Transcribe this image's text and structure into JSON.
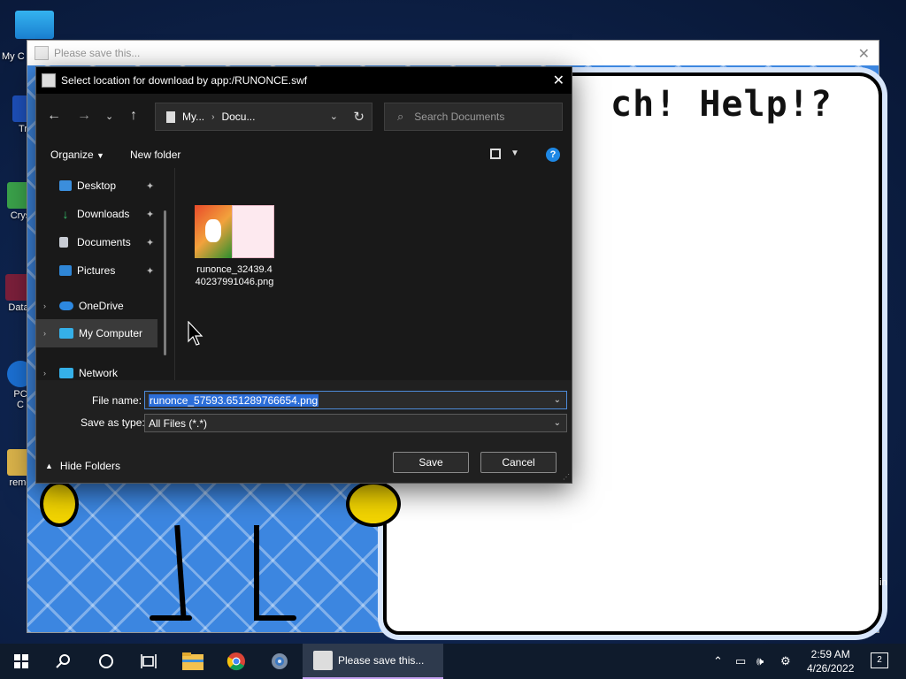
{
  "desktop": {
    "icons": [
      {
        "label": "My C"
      },
      {
        "label": "Tru"
      },
      {
        "label": "Crys"
      },
      {
        "label": "Data"
      },
      {
        "label": "PC"
      },
      {
        "label": "C"
      },
      {
        "label": "reme"
      }
    ]
  },
  "flash_window": {
    "title": "Please save this...",
    "speech_text": "ch! Help!?",
    "side_text": "in"
  },
  "dialog": {
    "title": "Select location for download by app:/RUNONCE.swf",
    "address": {
      "crumbs": [
        "My...",
        "Docu..."
      ]
    },
    "search_placeholder": "Search Documents",
    "commands": {
      "organize": "Organize",
      "new_folder": "New folder"
    },
    "nav_items": [
      {
        "label": "Desktop",
        "pinned": true
      },
      {
        "label": "Downloads",
        "pinned": true
      },
      {
        "label": "Documents",
        "pinned": true
      },
      {
        "label": "Pictures",
        "pinned": true
      },
      {
        "label": "OneDrive"
      },
      {
        "label": "My Computer",
        "selected": true
      },
      {
        "label": "Network"
      }
    ],
    "files": [
      {
        "name_line1": "runonce_32439.4",
        "name_line2": "40237991046.png"
      }
    ],
    "file_name_label": "File name:",
    "file_name_value": "runonce_57593.651289766654.png",
    "save_type_label": "Save as type:",
    "save_type_value": "All Files (*.*)",
    "hide_folders": "Hide Folders",
    "save_button": "Save",
    "cancel_button": "Cancel"
  },
  "taskbar": {
    "active_app": "Please save this...",
    "time": "2:59 AM",
    "date": "4/26/2022",
    "notification_count": "2"
  },
  "colors": {
    "dialog_bg": "#202020",
    "accent": "#2c6ed9",
    "taskbar_bg": "#0f1b2c"
  }
}
